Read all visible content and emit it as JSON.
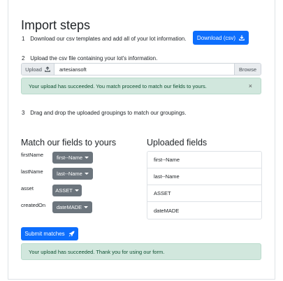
{
  "title": "Import steps",
  "steps": [
    {
      "num": "1",
      "text": "Download our csv templates and add all of your lot information."
    },
    {
      "num": "2",
      "text": "Upload the csv file containing your lot's information."
    },
    {
      "num": "3",
      "text": "Drag and drop the uploaded groupings to match our groupings."
    }
  ],
  "download_button": {
    "label": "Download (csv)",
    "icon": "download-icon"
  },
  "upload": {
    "button_label": "Upload",
    "icon": "upload-icon",
    "file_name": "artesiansoft",
    "browse_label": "Browse"
  },
  "alert_upload": {
    "text": "Your upload has succeeded. You match proceed to match our fields to yours.",
    "close": "×"
  },
  "match_title": "Match our fields to yours",
  "uploaded_title": "Uploaded fields",
  "fields": [
    {
      "label": "firstName",
      "selected": "first--Name"
    },
    {
      "label": "lastName",
      "selected": "last--Name"
    },
    {
      "label": "asset",
      "selected": "ASSET"
    },
    {
      "label": "createdOn",
      "selected": "dateMADE"
    }
  ],
  "uploaded_fields": [
    "first--Name",
    "last--Name",
    "ASSET",
    "dateMADE"
  ],
  "submit_button": {
    "label": "Submit matches",
    "icon": "rocket-icon"
  },
  "alert_final": {
    "text": "Your upload has succeeded. Thank you for using our form."
  },
  "colors": {
    "primary": "#0d6efd",
    "secondary": "#6c757d",
    "success_bg": "#d1e7dd",
    "success_text": "#0f5132"
  }
}
